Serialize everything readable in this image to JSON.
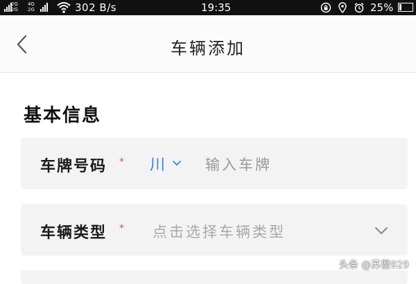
{
  "status_bar": {
    "network_1": [
      "2G",
      "2G"
    ],
    "network_2": [
      "4G",
      "2G"
    ],
    "speed": "302 B/s",
    "time": "19:35",
    "battery_percent": "25%",
    "battery_level": 0.25,
    "icons": [
      "signal-icon",
      "wifi-icon",
      "rotation-lock-icon",
      "location-icon",
      "alarm-icon",
      "battery-icon"
    ]
  },
  "header": {
    "title": "车辆添加",
    "back_icon": "chevron-left-icon"
  },
  "section": {
    "title": "基本信息"
  },
  "fields": {
    "plate": {
      "label": "车牌号码",
      "required": "*",
      "province": "川",
      "placeholder": "输入车牌"
    },
    "vehicle_type": {
      "label": "车辆类型",
      "required": "*",
      "placeholder": "点击选择车辆类型"
    }
  },
  "watermark": "头条 @苏璺929",
  "colors": {
    "accent": "#3d7fe0",
    "required": "#e74c3c",
    "row_background": "#f3f3f3",
    "status_bar": "#111111"
  }
}
